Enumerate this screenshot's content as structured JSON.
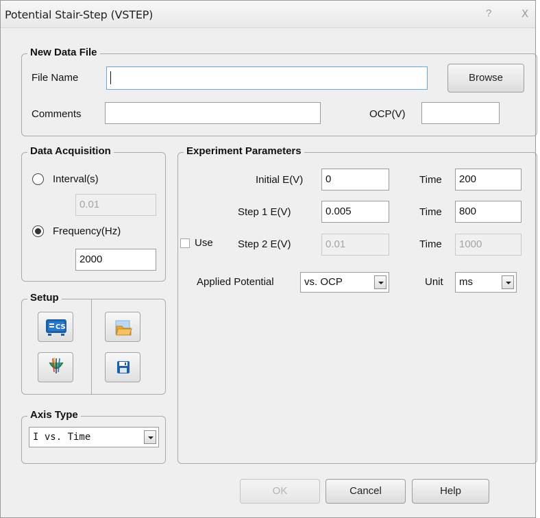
{
  "window": {
    "title": "Potential Stair-Step (VSTEP)",
    "help_glyph": "?",
    "close_glyph": "X"
  },
  "new_data_file": {
    "legend": "New Data File",
    "file_name_label": "File Name",
    "file_name_value": "",
    "browse_label": "Browse",
    "comments_label": "Comments",
    "comments_value": "",
    "ocp_label": "OCP(V)",
    "ocp_value": ""
  },
  "data_acquisition": {
    "legend": "Data Acquisition",
    "interval_label": "Interval(s)",
    "interval_value": "0.01",
    "frequency_label": "Frequency(Hz)",
    "frequency_value": "2000",
    "selected": "frequency"
  },
  "experiment_parameters": {
    "legend": "Experiment Parameters",
    "initial_label": "Initial E(V)",
    "initial_value": "0",
    "initial_time_label": "Time",
    "initial_time_value": "200",
    "step1_label": "Step 1 E(V)",
    "step1_value": "0.005",
    "step1_time_label": "Time",
    "step1_time_value": "800",
    "use_label": "Use",
    "use_checked": false,
    "step2_label": "Step 2 E(V)",
    "step2_value": "0.01",
    "step2_time_label": "Time",
    "step2_time_value": "1000",
    "applied_label": "Applied Potential",
    "applied_value": "vs. OCP",
    "unit_label": "Unit",
    "unit_value": "ms"
  },
  "setup": {
    "legend": "Setup",
    "cs_icon_text": "CS",
    "icons": [
      "instrument-cs-icon",
      "open-folder-icon",
      "electrode-icon",
      "save-disk-icon"
    ]
  },
  "axis_type": {
    "legend": "Axis Type",
    "value": "I vs. Time"
  },
  "footer": {
    "ok_label": "OK",
    "cancel_label": "Cancel",
    "help_label": "Help"
  },
  "colors": {
    "window_bg": "#efefef",
    "border": "#a9a9a9",
    "focus": "#6aa6d9",
    "icon_blue": "#1f5fa8",
    "icon_gold": "#e8a93a"
  }
}
